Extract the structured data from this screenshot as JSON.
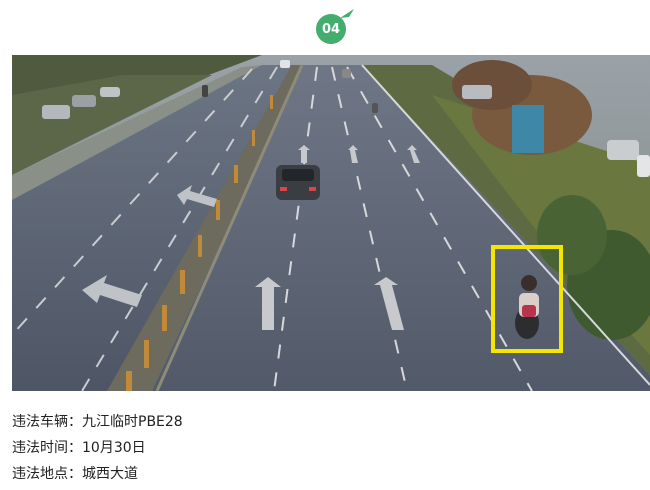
{
  "header": {
    "badge_number": "04",
    "badge_color": "#42ad6c"
  },
  "photo": {
    "description_icon": "traffic-camera-photo",
    "highlight_color": "#f5e600"
  },
  "info": {
    "rows": [
      {
        "label": "违法车辆：",
        "value": "九江临时PBE28"
      },
      {
        "label": "违法时间：",
        "value": "10月30日"
      },
      {
        "label": "违法地点：",
        "value": "城西大道"
      }
    ]
  }
}
